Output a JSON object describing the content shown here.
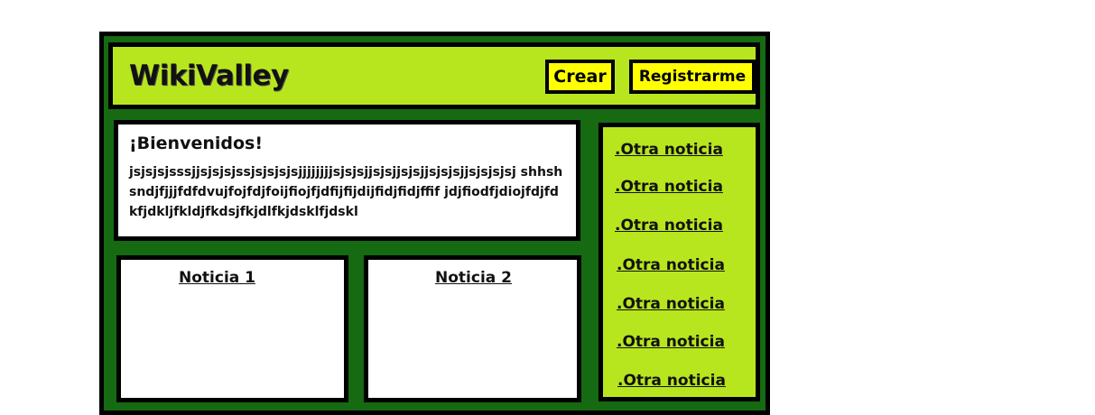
{
  "header": {
    "brand": "WikiValley",
    "create_label": "Crear",
    "register_label": "Registrarme"
  },
  "welcome": {
    "title": "¡Bienvenidos!",
    "body": "jsjsjsjsssjjsjsjsjssjsjsjsjsjjjjjjjjsjsjsjjsjsjjsjsjjsjsjsjjsjsjsjsj shhshsndjfjjjfdfdvujfojfdjfoijfiojfjdfijfijdijfidjfidjffif jdjfiodfjdiojfdjfdkfjdkljfkldjfkdsjfkjdlfkjdsklfjdskl"
  },
  "news": [
    {
      "title": "Noticia 1"
    },
    {
      "title": "Noticia 2"
    }
  ],
  "sidebar": {
    "links": [
      ".Otra noticia",
      ".Otra noticia",
      ".Otra noticia",
      ".Otra noticia",
      ".Otra noticia",
      ".Otra noticia",
      ".Otra noticia"
    ]
  },
  "colors": {
    "frame": "#166a12",
    "header": "#b8e61e",
    "button": "#ffff00"
  }
}
